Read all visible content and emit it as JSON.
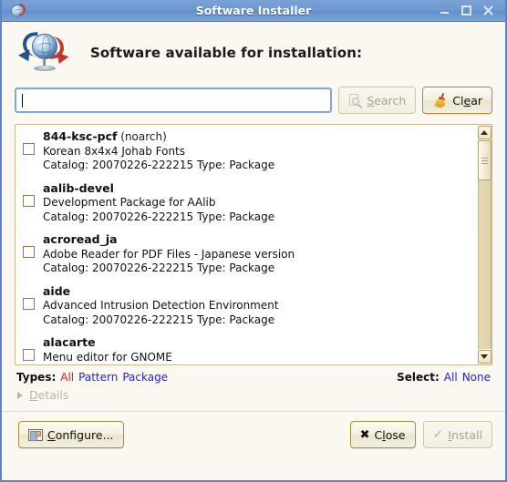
{
  "window": {
    "title": "Software Installer",
    "icon": "globe-sync-icon",
    "controls": {
      "minimize": "minimize-icon",
      "maximize": "maximize-icon",
      "close": "close-icon"
    }
  },
  "header": {
    "icon": "globe-download-icon",
    "title": "Software available for installation:"
  },
  "search": {
    "value": "",
    "placeholder": "",
    "search_button": {
      "label": "Search",
      "accel": "S",
      "enabled": false,
      "icon": "search-icon"
    },
    "clear_button": {
      "label": "Clear",
      "accel": "e",
      "enabled": true,
      "icon": "broom-icon"
    }
  },
  "packages": [
    {
      "name": "844-ksc-pcf",
      "arch": "(noarch)",
      "summary": "Korean 8x4x4 Johab Fonts",
      "meta": "Catalog: 20070226-222215 Type: Package",
      "checked": false
    },
    {
      "name": "aalib-devel",
      "arch": "",
      "summary": "Development Package for AAlib",
      "meta": "Catalog: 20070226-222215 Type: Package",
      "checked": false
    },
    {
      "name": "acroread_ja",
      "arch": "",
      "summary": "Adobe Reader for PDF Files - Japanese version",
      "meta": "Catalog: 20070226-222215 Type: Package",
      "checked": false
    },
    {
      "name": "aide",
      "arch": "",
      "summary": "Advanced Intrusion Detection Environment",
      "meta": "Catalog: 20070226-222215 Type: Package",
      "checked": false
    },
    {
      "name": "alacarte",
      "arch": "",
      "summary": "Menu editor for GNOME",
      "meta": "",
      "checked": false
    }
  ],
  "scrollbar": {
    "up": "scroll-up-icon",
    "down": "scroll-down-icon",
    "position": "top"
  },
  "types": {
    "label": "Types:",
    "options": [
      {
        "label": "All",
        "selected": true
      },
      {
        "label": "Pattern",
        "selected": false
      },
      {
        "label": "Package",
        "selected": false
      }
    ]
  },
  "select": {
    "label": "Select:",
    "options": [
      {
        "label": "All"
      },
      {
        "label": "None"
      }
    ]
  },
  "details": {
    "label": "Details",
    "accel": "D",
    "expanded": false,
    "enabled": false
  },
  "footer": {
    "configure": {
      "label": "Configure...",
      "accel": "C",
      "enabled": true,
      "icon": "window-config-icon"
    },
    "close": {
      "label": "Close",
      "accel": "l",
      "enabled": true,
      "icon": "x-icon"
    },
    "install": {
      "label": "Install",
      "accel": "I",
      "enabled": false,
      "icon": "check-icon"
    }
  },
  "colors": {
    "titlebar": "#6f99d0",
    "background": "#faf8f0",
    "link": "#2222dd",
    "active_link": "#e01b1b",
    "button_border": "#b08c3e"
  }
}
